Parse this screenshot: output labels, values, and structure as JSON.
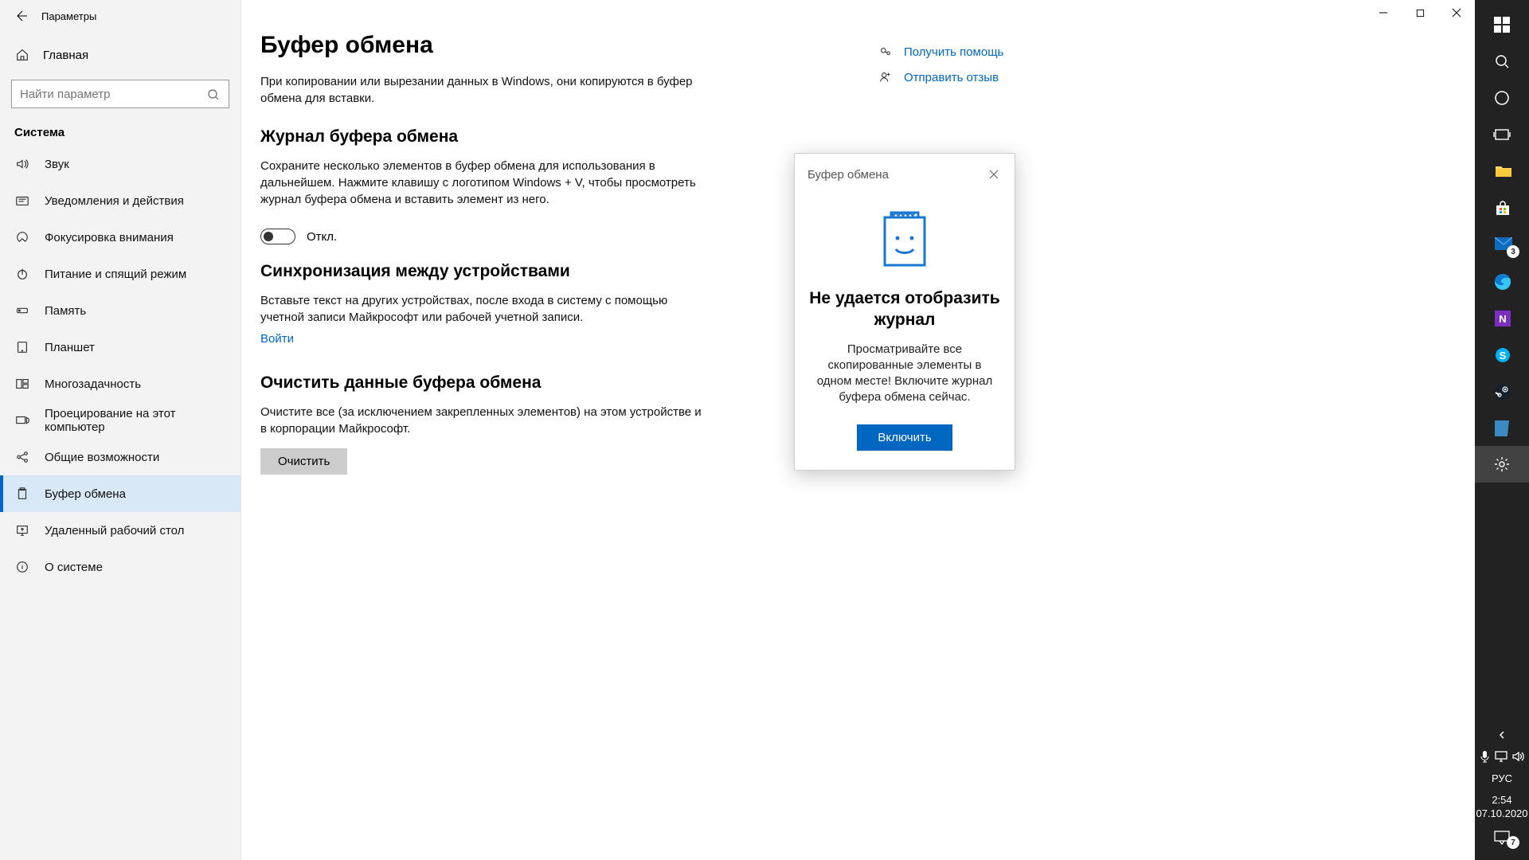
{
  "window": {
    "title": "Параметры"
  },
  "home_label": "Главная",
  "search": {
    "placeholder": "Найти параметр"
  },
  "section": "Система",
  "nav": [
    {
      "label": "Звук"
    },
    {
      "label": "Уведомления и действия"
    },
    {
      "label": "Фокусировка внимания"
    },
    {
      "label": "Питание и спящий режим"
    },
    {
      "label": "Память"
    },
    {
      "label": "Планшет"
    },
    {
      "label": "Многозадачность"
    },
    {
      "label": "Проецирование на этот компьютер"
    },
    {
      "label": "Общие возможности"
    },
    {
      "label": "Буфер обмена"
    },
    {
      "label": "Удаленный рабочий стол"
    },
    {
      "label": "О системе"
    }
  ],
  "page": {
    "title": "Буфер обмена",
    "intro": "При копировании или вырезании данных в Windows, они копируются в буфер обмена для вставки.",
    "s1": {
      "title": "Журнал буфера обмена",
      "body": "Сохраните несколько элементов в буфер обмена для использования в дальнейшем. Нажмите клавишу с логотипом Windows + V, чтобы просмотреть журнал буфера обмена и вставить элемент из него.",
      "toggle": "Откл."
    },
    "s2": {
      "title": "Синхронизация между устройствами",
      "body": "Вставьте текст на других устройствах, после входа в систему с помощью учетной записи Майкрософт или рабочей учетной записи.",
      "link": "Войти"
    },
    "s3": {
      "title": "Очистить данные буфера обмена",
      "body": "Очистите все (за исключением закрепленных элементов) на этом устройстве и в корпорации Майкрософт.",
      "button": "Очистить"
    }
  },
  "aside": {
    "help": "Получить помощь",
    "feedback": "Отправить отзыв"
  },
  "popup": {
    "header": "Буфер обмена",
    "title": "Не удается отобразить журнал",
    "body": "Просматривайте все скопированные элементы в одном месте! Включите журнал буфера обмена сейчас.",
    "button": "Включить"
  },
  "taskbar": {
    "lang": "РУС",
    "time": "2:54",
    "date": "07.10.2020",
    "mail_badge": "3",
    "action_badge": "7"
  }
}
